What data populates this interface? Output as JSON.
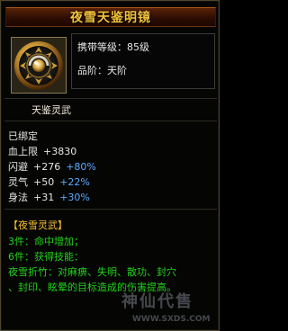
{
  "title": "夜雪天鉴明镜",
  "item_info": {
    "carry_level": "携带等级：85级",
    "rank": "品阶：天阶"
  },
  "weapon_type": "天鉴灵武",
  "bound": "已绑定",
  "stats": [
    {
      "name": "血上限",
      "value": "+3830",
      "percent": ""
    },
    {
      "name": "闪避",
      "value": "+276",
      "percent": "+80%"
    },
    {
      "name": "灵气",
      "value": "+50",
      "percent": "+22%"
    },
    {
      "name": "身法",
      "value": "+31",
      "percent": "+30%"
    }
  ],
  "set": {
    "name": "【夜雪灵武】",
    "piece3": "3件：命中增加；",
    "piece6": "6件：获得技能：",
    "skill_line1": "夜雪折竹：对麻痹、失明、散功、封穴",
    "skill_line2": "、封印、眩晕的目标造成的伤害提高。"
  },
  "watermark": {
    "logo": "神仙代售",
    "url": "WWW.SXDS.COM"
  },
  "colors": {
    "title": "#f4c23a",
    "set_name": "#f5c02f",
    "set_text": "#22d21a",
    "percent": "#5aa9ff",
    "text": "#e6e6e6"
  },
  "icon": "mirror-disc-icon"
}
